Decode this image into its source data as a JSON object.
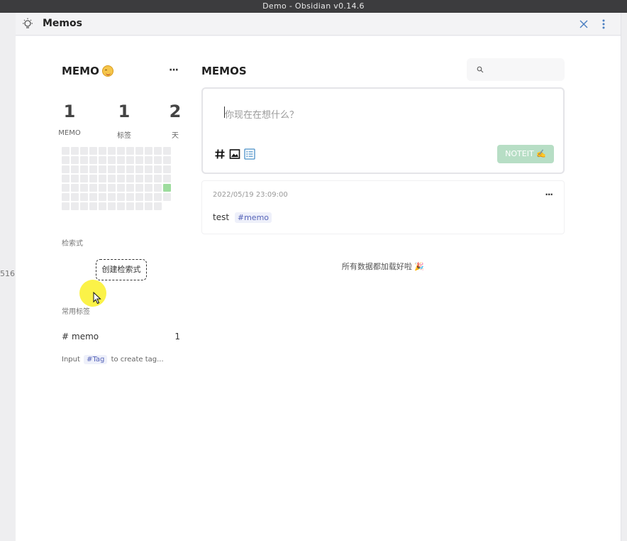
{
  "window_title": "Demo - Obsidian v0.14.6",
  "left_gutter_text": "516",
  "view": {
    "title": "Memos",
    "icons": {
      "left": "lightbulb-icon",
      "close": "close-icon",
      "more": "more-vertical-icon"
    }
  },
  "sidebar": {
    "title": "MEMO",
    "more_label": "···",
    "stats": [
      {
        "value": "1",
        "label": "MEMO"
      },
      {
        "value": "1",
        "label": "标签"
      },
      {
        "value": "2",
        "label": "天"
      }
    ],
    "heatmap_active_cells": [
      "row5-col12"
    ],
    "queries_label": "检索式",
    "create_query_label": "创建检索式",
    "tags_label": "常用标签",
    "tags": [
      {
        "hash": "#",
        "name": "memo",
        "count": "1"
      }
    ],
    "hint": {
      "before": "Input",
      "pill": "#Tag",
      "after": "to create tag..."
    }
  },
  "main": {
    "title": "MEMOS",
    "search_placeholder": "",
    "editor": {
      "placeholder": "你现在在想什么？",
      "tools": [
        "hash-icon",
        "image-icon",
        "list-icon"
      ],
      "submit_label": "NOTEIT ✍️"
    },
    "memos": [
      {
        "timestamp": "2022/05/19 23:09:00",
        "text": "test",
        "tag": "#memo",
        "more_label": "···"
      }
    ],
    "loaded_message": "所有数据都加载好啦 🎉"
  },
  "colors": {
    "accent": "#b7dec5",
    "heatmap_active": "#9edc9e",
    "tag_text": "#5563b8",
    "tag_bg": "#eef0fa"
  }
}
